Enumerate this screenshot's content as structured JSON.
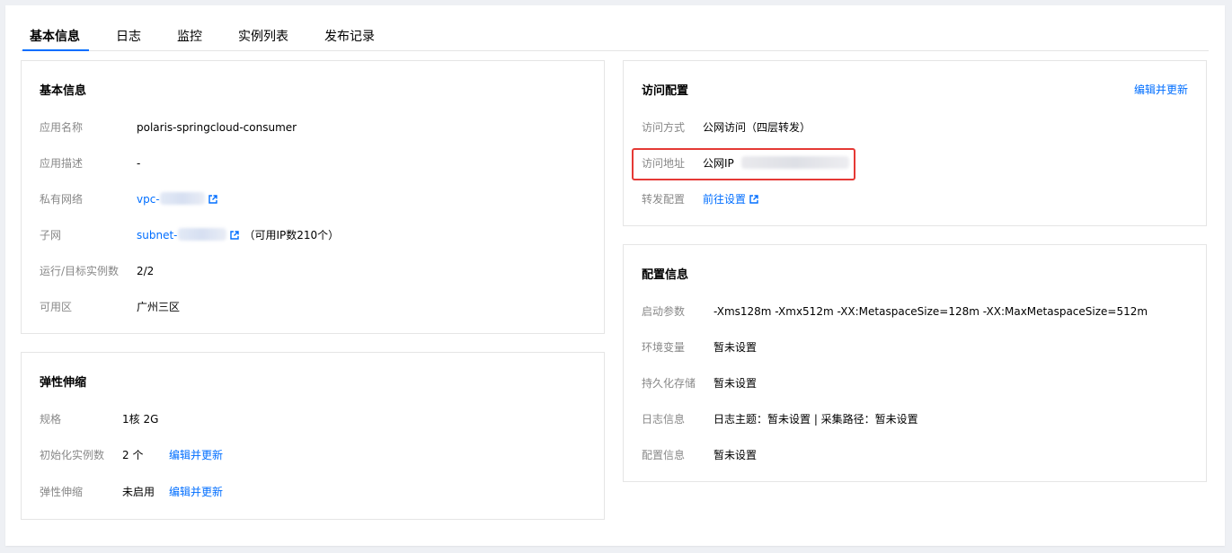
{
  "tabs": [
    {
      "label": "基本信息",
      "active": true
    },
    {
      "label": "日志",
      "active": false
    },
    {
      "label": "监控",
      "active": false
    },
    {
      "label": "实例列表",
      "active": false
    },
    {
      "label": "发布记录",
      "active": false
    }
  ],
  "basic_info": {
    "title": "基本信息",
    "app_name_label": "应用名称",
    "app_name": "polaris-springcloud-consumer",
    "desc_label": "应用描述",
    "desc": "-",
    "vpc_label": "私有网络",
    "vpc_prefix": "vpc-",
    "subnet_label": "子网",
    "subnet_prefix": "subnet-",
    "subnet_ip_note": "（可用IP数210个）",
    "instances_label": "运行/目标实例数",
    "instances": "2/2",
    "zone_label": "可用区",
    "zone": "广州三区"
  },
  "scaling": {
    "title": "弹性伸缩",
    "spec_label": "规格",
    "spec": "1核 2G",
    "init_label": "初始化实例数",
    "init": "2 个",
    "init_action": "编辑并更新",
    "auto_label": "弹性伸缩",
    "auto": "未启用",
    "auto_action": "编辑并更新"
  },
  "access": {
    "title": "访问配置",
    "edit_action": "编辑并更新",
    "method_label": "访问方式",
    "method": "公网访问（四层转发）",
    "address_label": "访问地址",
    "address_prefix": "公网IP",
    "forward_label": "转发配置",
    "forward_link": "前往设置"
  },
  "config": {
    "title": "配置信息",
    "args_label": "启动参数",
    "args": "-Xms128m -Xmx512m -XX:MetaspaceSize=128m -XX:MaxMetaspaceSize=512m",
    "env_label": "环境变量",
    "env": "暂未设置",
    "storage_label": "持久化存储",
    "storage": "暂未设置",
    "log_label": "日志信息",
    "log": "日志主题：暂未设置 | 采集路径：暂未设置",
    "cfg_label": "配置信息",
    "cfg": "暂未设置"
  },
  "colors": {
    "accent": "#006eff",
    "highlight": "#e53935",
    "label": "#888888"
  }
}
